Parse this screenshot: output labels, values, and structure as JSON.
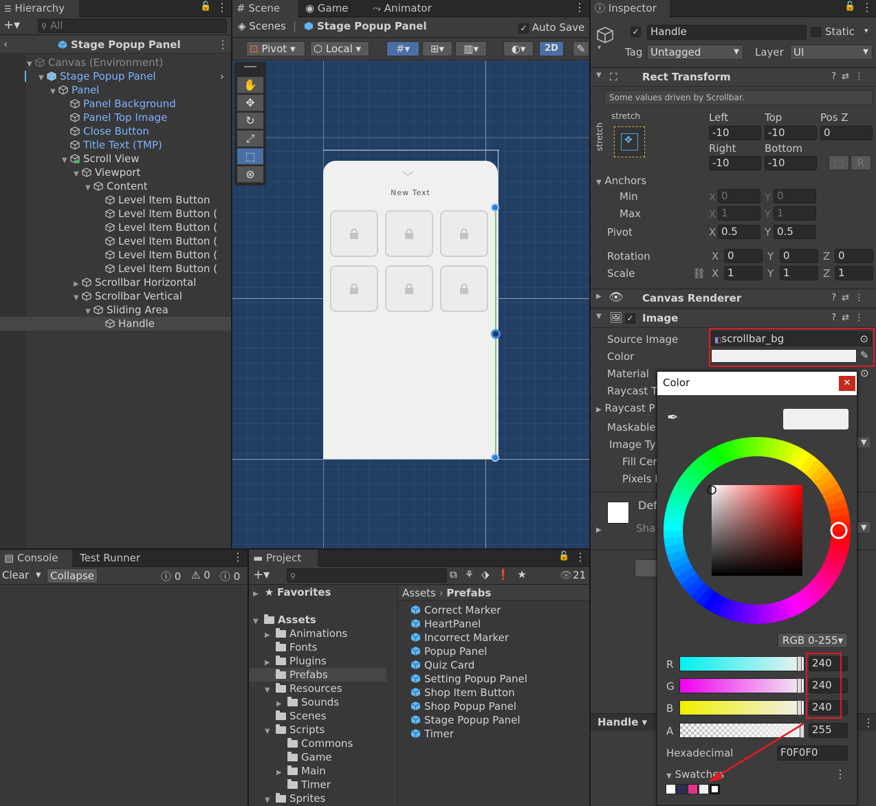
{
  "hierarchy": {
    "tab": "Hierarchy",
    "search_placeholder": "All",
    "breadcrumb": "Stage Popup Panel",
    "items": [
      {
        "label": "Canvas (Environment)",
        "style": "grey"
      },
      {
        "label": "Stage Popup Panel",
        "style": "blue"
      },
      {
        "label": "Panel",
        "style": "blue"
      },
      {
        "label": "Panel Background",
        "style": "blue"
      },
      {
        "label": "Panel Top Image",
        "style": "blue"
      },
      {
        "label": "Close Button",
        "style": "blue"
      },
      {
        "label": "Title Text (TMP)",
        "style": "blue"
      },
      {
        "label": "Scroll View",
        "style": "normal"
      },
      {
        "label": "Viewport",
        "style": "normal"
      },
      {
        "label": "Content",
        "style": "normal"
      },
      {
        "label": "Level Item Button",
        "style": "normal"
      },
      {
        "label": "Level Item Button (",
        "style": "normal"
      },
      {
        "label": "Level Item Button (",
        "style": "normal"
      },
      {
        "label": "Level Item Button (",
        "style": "normal"
      },
      {
        "label": "Level Item Button (",
        "style": "normal"
      },
      {
        "label": "Level Item Button (",
        "style": "normal"
      },
      {
        "label": "Scrollbar Horizontal",
        "style": "normal"
      },
      {
        "label": "Scrollbar Vertical",
        "style": "normal"
      },
      {
        "label": "Sliding Area",
        "style": "normal"
      },
      {
        "label": "Handle",
        "style": "selected"
      }
    ]
  },
  "scene": {
    "tabs": [
      "Scene",
      "Game",
      "Animator"
    ],
    "scenes_label": "Scenes",
    "breadcrumb": "Stage Popup Panel",
    "auto_save": "Auto Save",
    "pivot": "Pivot",
    "local": "Local",
    "mode_2d": "2D",
    "popup_title": "New Text"
  },
  "console": {
    "tabs": [
      "Console",
      "Test Runner"
    ],
    "clear": "Clear",
    "collapse": "Collapse",
    "counts": [
      "0",
      "0",
      "0"
    ]
  },
  "project": {
    "tab": "Project",
    "count": "21",
    "favorites": "Favorites",
    "tree": [
      {
        "label": "Assets",
        "bold": true
      },
      {
        "label": "Animations"
      },
      {
        "label": "Fonts"
      },
      {
        "label": "Plugins"
      },
      {
        "label": "Prefabs",
        "selected": true
      },
      {
        "label": "Resources"
      },
      {
        "label": "Sounds"
      },
      {
        "label": "Scenes"
      },
      {
        "label": "Scripts"
      },
      {
        "label": "Commons"
      },
      {
        "label": "Game"
      },
      {
        "label": "Main"
      },
      {
        "label": "Timer"
      },
      {
        "label": "Sprites"
      }
    ],
    "path": [
      "Assets",
      "Prefabs"
    ],
    "assets": [
      "Correct Marker",
      "HeartPanel",
      "Incorrect Marker",
      "Popup Panel",
      "Quiz Card",
      "Setting Popup Panel",
      "Shop Item Button",
      "Shop Popup Panel",
      "Stage Popup Panel",
      "Timer"
    ]
  },
  "inspector": {
    "tab": "Inspector",
    "name": "Handle",
    "static": "Static",
    "tag_label": "Tag",
    "tag_value": "Untagged",
    "layer_label": "Layer",
    "layer_value": "UI",
    "rect_transform": "Rect Transform",
    "driven_note": "Some values driven by Scrollbar.",
    "stretch": "stretch",
    "left_label": "Left",
    "left": "-10",
    "top_label": "Top",
    "top": "-10",
    "posz_label": "Pos Z",
    "posz": "0",
    "right_label": "Right",
    "right": "-10",
    "bottom_label": "Bottom",
    "bottom": "-10",
    "anchors": "Anchors",
    "min": "Min",
    "max": "Max",
    "min_x": "0",
    "min_y": "0",
    "max_x": "1",
    "max_y": "1",
    "pivot": "Pivot",
    "pivot_x": "0.5",
    "pivot_y": "0.5",
    "rotation": "Rotation",
    "rot_x": "0",
    "rot_y": "0",
    "rot_z": "0",
    "scale": "Scale",
    "scale_x": "1",
    "scale_y": "1",
    "scale_z": "1",
    "canvas_renderer": "Canvas Renderer",
    "image": "Image",
    "source_image_label": "Source Image",
    "source_image": "scrollbar_bg",
    "color_label": "Color",
    "color_value": "#F0F0F0",
    "material_label": "Material",
    "raycast_target": "Raycast T",
    "raycast_padding": "Raycast P",
    "maskable": "Maskable",
    "image_type": "Image Typ",
    "fill_center": "Fill Cer",
    "pixels": "Pixels I",
    "def": "Def",
    "sha": "Sha",
    "footer_name": "Handle"
  },
  "color_picker": {
    "title": "Color",
    "mode": "RGB 0-255",
    "r_label": "R",
    "r": "240",
    "g_label": "G",
    "g": "240",
    "b_label": "B",
    "b": "240",
    "a_label": "A",
    "a": "255",
    "hex_label": "Hexadecimal",
    "hex": "F0F0F0",
    "swatches_label": "Swatches",
    "swatches": [
      "#ffffff",
      "#2b2f54",
      "#e6328a",
      "#f0f0f0",
      "#ffffff"
    ],
    "preview_color": "#f0f0f0"
  },
  "colors": {
    "accent_blue": "#7cb4ff",
    "scene_bg": "#1f3a5f",
    "highlight_red": "#e11b22"
  }
}
